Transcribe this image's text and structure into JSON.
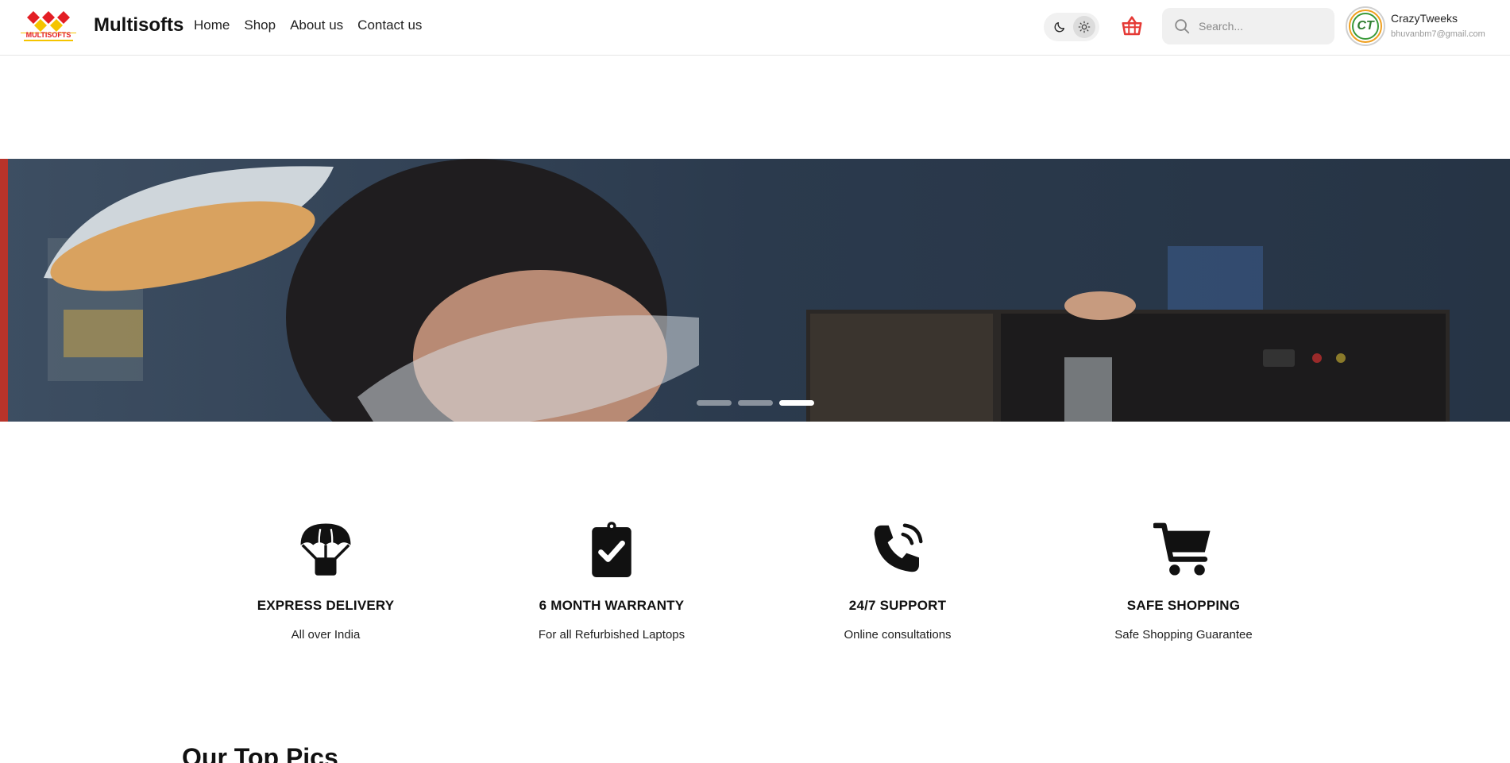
{
  "header": {
    "logo_text": "MULTISOFTS",
    "brand": "Multisofts",
    "nav": [
      "Home",
      "Shop",
      "About us",
      "Contact us"
    ],
    "search_placeholder": "Search...",
    "user": {
      "name": "CrazyTweeks",
      "email": "bhuvanbm7@gmail.com",
      "avatar_text": "CT"
    }
  },
  "hero": {
    "slides": 3,
    "active_slide": 3
  },
  "features": [
    {
      "icon": "parachute-box-icon",
      "title": "EXPRESS DELIVERY",
      "subtitle": "All over India"
    },
    {
      "icon": "clipboard-check-icon",
      "title": "6 MONTH WARRANTY",
      "subtitle": "For all Refurbished Laptops"
    },
    {
      "icon": "phone-volume-icon",
      "title": "24/7 SUPPORT",
      "subtitle": "Online consultations"
    },
    {
      "icon": "shopping-cart-icon",
      "title": "SAFE SHOPPING",
      "subtitle": "Safe Shopping Guarantee"
    }
  ],
  "section": {
    "title": "Our Top Pics"
  },
  "colors": {
    "cart_red": "#e53935",
    "logo_red": "#e31e24",
    "logo_yellow": "#f5c400"
  }
}
